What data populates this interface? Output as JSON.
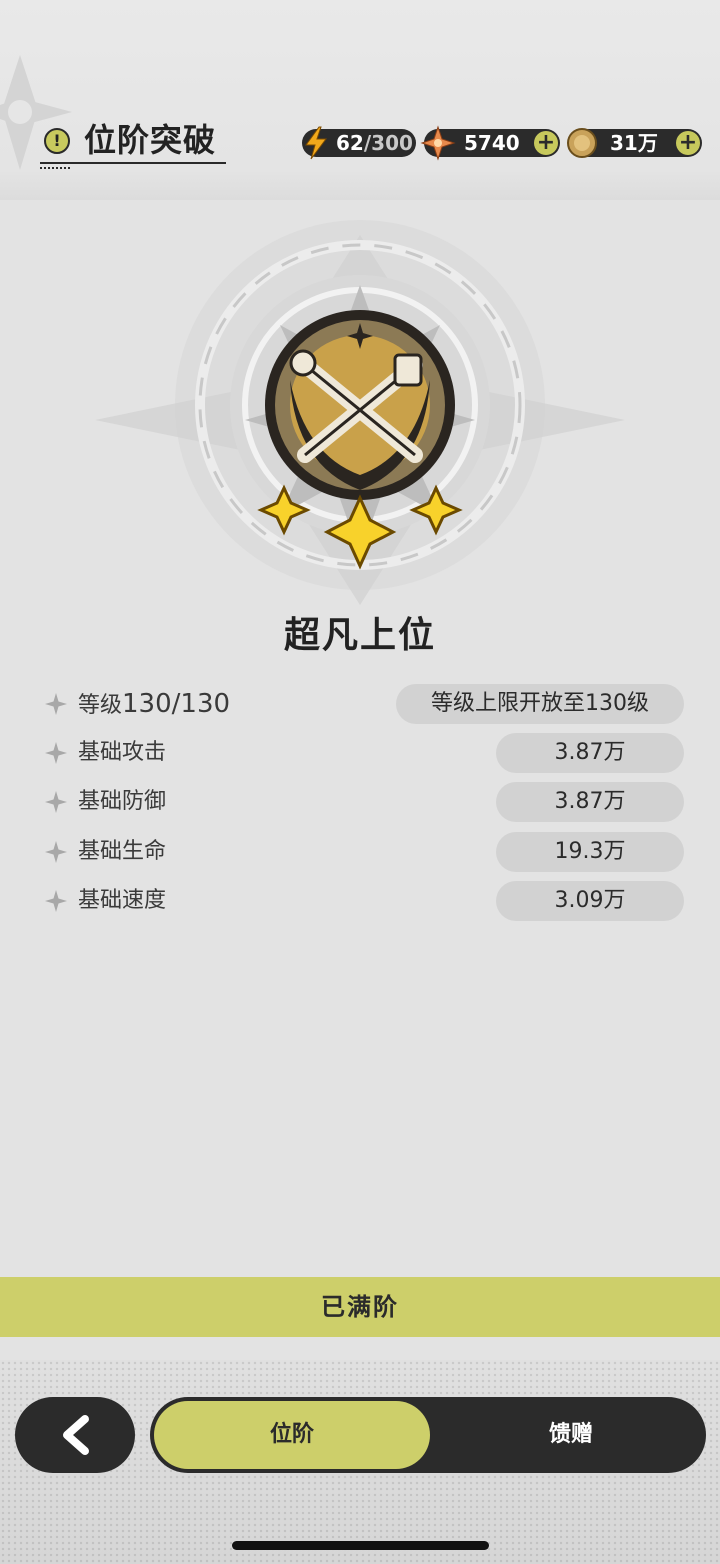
{
  "header": {
    "title": "位阶突破",
    "energy": {
      "current": "62",
      "max": "/300"
    },
    "crystals": "5740",
    "coins": "31万"
  },
  "rank": {
    "name": "超凡上位",
    "stars": 3
  },
  "stats": {
    "level": {
      "label": "等级",
      "value": "130/130",
      "pill": "等级上限开放至130级"
    },
    "rows": [
      {
        "label": "基础攻击",
        "value": "3.87万"
      },
      {
        "label": "基础防御",
        "value": "3.87万"
      },
      {
        "label": "基础生命",
        "value": "19.3万"
      },
      {
        "label": "基础速度",
        "value": "3.09万"
      }
    ]
  },
  "status_bar_text": "已满阶",
  "tabs": [
    {
      "label": "位阶",
      "active": true
    },
    {
      "label": "馈赠",
      "active": false
    }
  ],
  "colors": {
    "accent": "#cdcf6a",
    "dark": "#2b2b2b",
    "background": "#e3e3e3"
  }
}
